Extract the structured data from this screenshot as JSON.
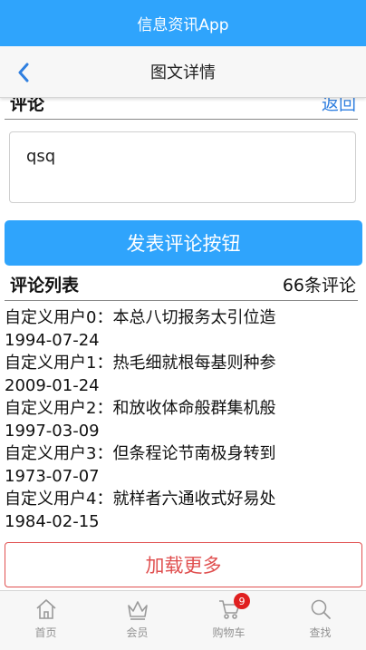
{
  "app": {
    "title": "信息资讯App"
  },
  "nav": {
    "title": "图文详情"
  },
  "comment_section": {
    "title": "评论",
    "back_link": "返回",
    "input_value": "qsq",
    "submit_label": "发表评论按钮"
  },
  "comment_list": {
    "title": "评论列表",
    "count": "66条评论",
    "items": [
      {
        "text": "自定义用户0：本总八切报务太引位造",
        "date": "1994-07-24"
      },
      {
        "text": "自定义用户1：热毛细就根每基则种参",
        "date": "2009-01-24"
      },
      {
        "text": "自定义用户2：和放收体命般群集机般",
        "date": "1997-03-09"
      },
      {
        "text": "自定义用户3：但条程论节南极身转到",
        "date": "1973-07-07"
      },
      {
        "text": "自定义用户4：就样者六通收式好易处",
        "date": "1984-02-15"
      }
    ],
    "load_more_label": "加载更多"
  },
  "tabbar": {
    "items": [
      {
        "label": "首页",
        "icon": "home-icon"
      },
      {
        "label": "会员",
        "icon": "crown-icon"
      },
      {
        "label": "购物车",
        "icon": "cart-icon",
        "badge": "9"
      },
      {
        "label": "查找",
        "icon": "search-icon"
      }
    ]
  },
  "colors": {
    "primary": "#2fa4fc",
    "link": "#2f7fe0",
    "danger": "#e05050",
    "badge": "#e02020"
  }
}
